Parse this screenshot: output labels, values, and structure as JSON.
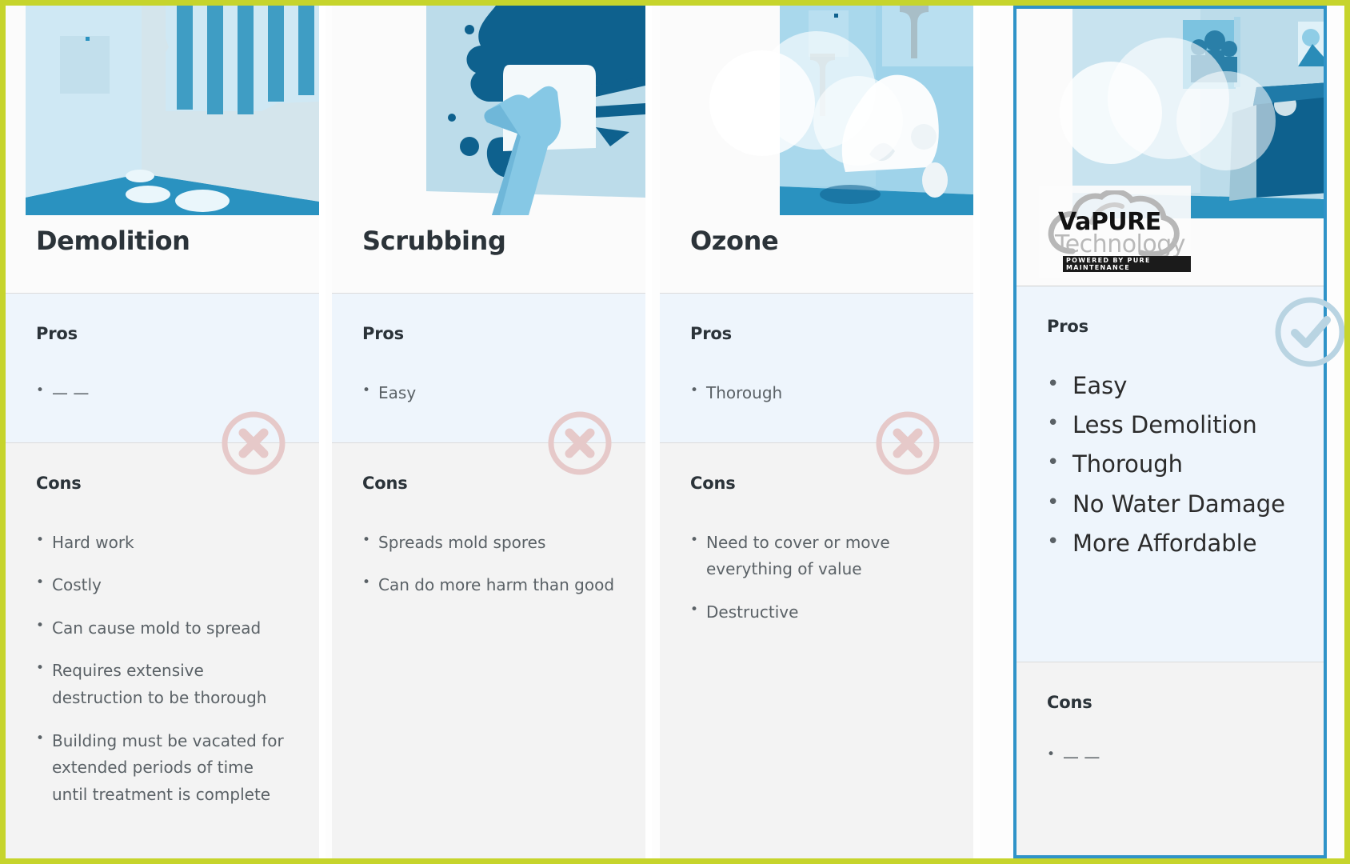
{
  "frame": {
    "border_color": "#c6d42c",
    "highlight_border_color": "#2f93c8"
  },
  "labels": {
    "pros": "Pros",
    "cons": "Cons",
    "empty_item": "— —"
  },
  "logo": {
    "line1": "VaPURE",
    "line2": "Technology",
    "tagline": "POWERED BY PURE MAINTENANCE"
  },
  "columns": [
    {
      "id": "demolition",
      "title": "Demolition",
      "highlighted": false,
      "badge": "x-circle-icon",
      "pros": [
        "— —"
      ],
      "cons": [
        "Hard work",
        "Costly",
        "Can cause mold to spread",
        "Requires extensive destruction to be thorough",
        "Building must be vacated for extended periods of time until treatment is complete"
      ]
    },
    {
      "id": "scrubbing",
      "title": "Scrubbing",
      "highlighted": false,
      "badge": "x-circle-icon",
      "pros": [
        "Easy"
      ],
      "cons": [
        "Spreads mold spores",
        "Can do more harm than good"
      ]
    },
    {
      "id": "ozone",
      "title": "Ozone",
      "highlighted": false,
      "badge": "x-circle-icon",
      "pros": [
        "Thorough"
      ],
      "cons": [
        "Need to cover or move everything of value",
        "Destructive"
      ]
    },
    {
      "id": "vapure",
      "title": "",
      "highlighted": true,
      "badge": "check-circle-icon",
      "pros": [
        "Easy",
        "Less Demolition",
        "Thorough",
        "No Water Damage",
        "More Affordable"
      ],
      "cons": [
        "— —"
      ]
    }
  ],
  "colors": {
    "pros_bg": "#eef5fc",
    "cons_bg": "#f3f3f3",
    "x_badge": "#e6c9c9",
    "check_badge": "#b9d4e2",
    "illustration_primary": "#2d90bd",
    "illustration_dark": "#0e618e",
    "illustration_light": "#bfe0ef"
  }
}
